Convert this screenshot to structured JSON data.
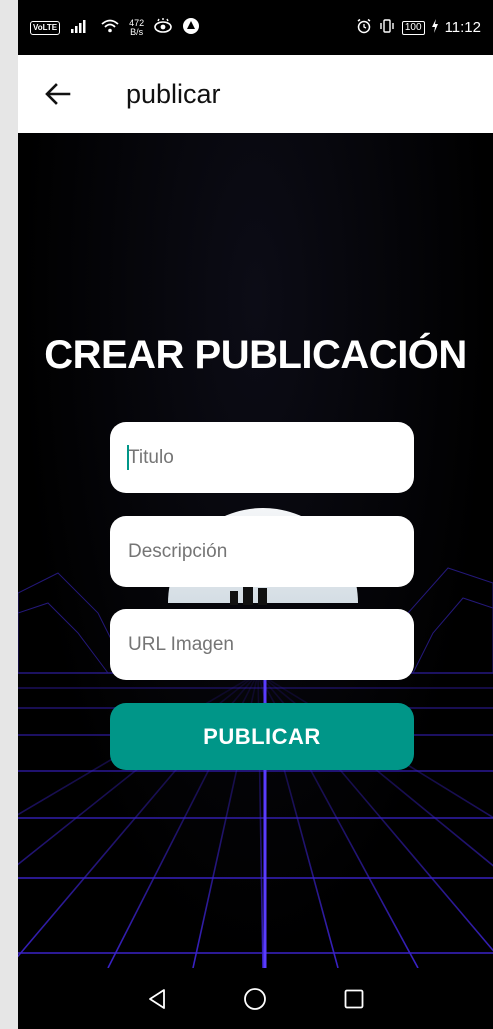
{
  "status_bar": {
    "carrier": "VoLTE",
    "net_speed_value": "472",
    "net_speed_unit": "B/s",
    "battery": "100",
    "time": "11:12",
    "icons": [
      "signal-icon",
      "wifi-icon",
      "eye-icon",
      "app-icon",
      "alarm-icon",
      "vibrate-icon",
      "battery-icon",
      "charging-icon"
    ]
  },
  "app_bar": {
    "title": "publicar",
    "back_icon": "arrow-left-icon"
  },
  "form": {
    "heading": "CREAR PUBLICACIÓN",
    "title_placeholder": "Titulo",
    "description_placeholder": "Descripción",
    "url_placeholder": "URL Imagen",
    "submit_label": "PUBLICAR"
  },
  "colors": {
    "accent": "#009688",
    "grid": "#3a22c8",
    "background": "#000000",
    "app_bar": "#ffffff"
  },
  "nav_bar": {
    "icons": [
      "back-triangle-icon",
      "home-circle-icon",
      "recents-square-icon"
    ]
  }
}
